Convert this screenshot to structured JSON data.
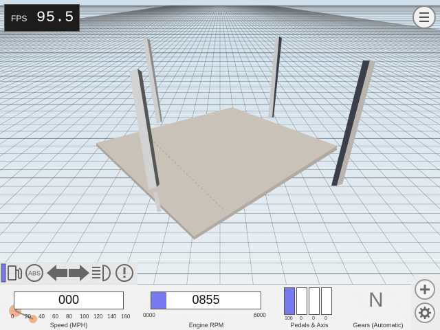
{
  "fps": {
    "label": "FPS",
    "value": "95.5"
  },
  "speed": {
    "value": "000",
    "ticks": [
      "0",
      "20",
      "40",
      "60",
      "80",
      "100",
      "120",
      "140",
      "160"
    ],
    "label": "Speed (MPH)"
  },
  "rpm": {
    "value": "0855",
    "min": "0000",
    "max": "6000",
    "label": "Engine RPM",
    "fill_fraction": 0.14
  },
  "pedals": {
    "label": "Pedals & Axis",
    "values": [
      "100",
      "0",
      "0",
      "0"
    ],
    "fill_fractions": [
      1,
      0,
      0,
      0
    ]
  },
  "gear": {
    "value": "N",
    "label": "Gears (Automatic)"
  },
  "indicators": {
    "abs_label": "ABS"
  },
  "colors": {
    "accent": "#7777ee",
    "grid": "#222222",
    "platform": "#c8c0b5"
  }
}
